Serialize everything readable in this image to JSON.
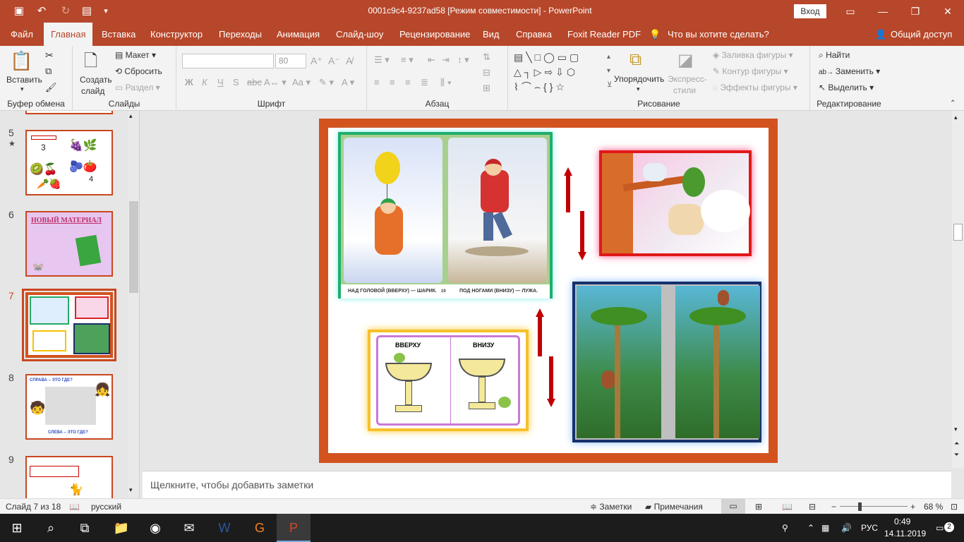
{
  "titlebar": {
    "title": "0001c9c4-9237ad58 [Режим совместимости]  -  PowerPoint",
    "signin": "Вход",
    "quick_access": [
      "save-icon",
      "undo-icon",
      "redo-icon",
      "present-from-start-icon",
      "customize-icon"
    ]
  },
  "tabs": [
    "Файл",
    "Главная",
    "Вставка",
    "Конструктор",
    "Переходы",
    "Анимация",
    "Слайд-шоу",
    "Рецензирование",
    "Вид",
    "Справка",
    "Foxit Reader PDF"
  ],
  "tell_me": "Что вы хотите сделать?",
  "share": "Общий доступ",
  "ribbon": {
    "clipboard": {
      "paste": "Вставить",
      "label": "Буфер обмена"
    },
    "slides": {
      "new_slide_1": "Создать",
      "new_slide_2": "слайд",
      "layout": "Макет",
      "reset": "Сбросить",
      "section": "Раздел",
      "label": "Слайды"
    },
    "font": {
      "size": "80",
      "bold": "Ж",
      "italic": "К",
      "underline": "Ч",
      "strike": "S",
      "label": "Шрифт"
    },
    "paragraph": {
      "label": "Абзац"
    },
    "drawing": {
      "arrange": "Упорядочить",
      "quick_styles_1": "Экспресс-",
      "quick_styles_2": "стили",
      "fill": "Заливка фигуры",
      "outline": "Контур фигуры",
      "effects": "Эффекты фигуры",
      "label": "Рисование"
    },
    "editing": {
      "find": "Найти",
      "replace": "Заменить",
      "select": "Выделить",
      "label": "Редактирование"
    }
  },
  "thumbnails": [
    {
      "num": "5",
      "star": "★"
    },
    {
      "num": "6",
      "title": "НОВЫЙ МАТЕРИАЛ"
    },
    {
      "num": "7"
    },
    {
      "num": "8",
      "top": "СПРАВА – ЭТО ГДЕ?",
      "bottom": "СЛЕВА – ЭТО ГДЕ?"
    },
    {
      "num": "9"
    }
  ],
  "slide": {
    "caption_left": "НАД ГОЛОВОЙ (ВВЕРХУ) — ШАРИК.",
    "caption_right": "ПОД НОГАМИ (ВНИЗУ) — ЛУЖА.",
    "page_no": "10",
    "label_up": "ВВЕРХУ",
    "label_down": "ВНИЗУ"
  },
  "notes_placeholder": "Щелкните, чтобы добавить заметки",
  "statusbar": {
    "slide_of": "Слайд 7 из 18",
    "language": "русский",
    "notes": "Заметки",
    "comments": "Примечания",
    "zoom": "68 %",
    "zoom_value": 0.68
  },
  "taskbar": {
    "lang": "РУС",
    "time": "0:49",
    "date": "14.11.2019",
    "notif": "2"
  },
  "colors": {
    "accent": "#b7472a",
    "slide_border": "#d3531f"
  }
}
